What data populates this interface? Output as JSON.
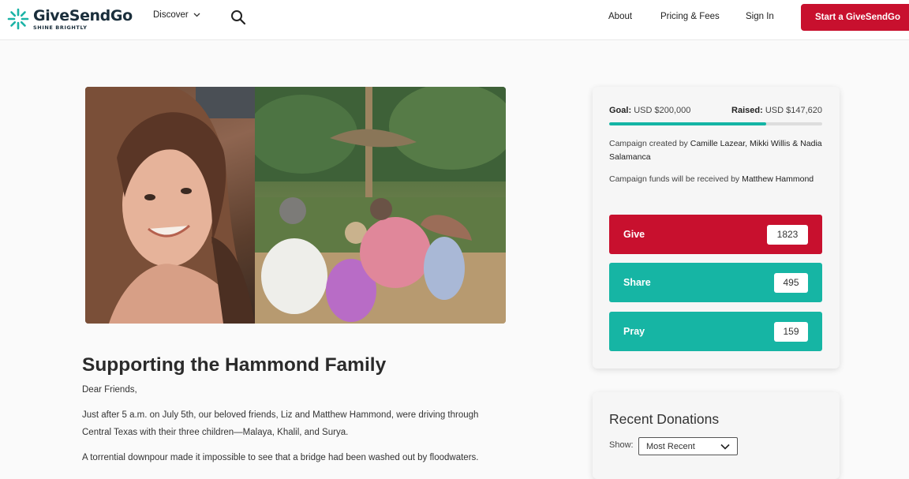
{
  "header": {
    "logo_word": "GiveSendGo",
    "logo_tagline": "SHINE BRIGHTLY",
    "discover_label": "Discover",
    "about_label": "About",
    "pricing_label": "Pricing & Fees",
    "signin_label": "Sign In",
    "start_label": "Start a GiveSendGo"
  },
  "campaign": {
    "title": "Supporting the Hammond Family",
    "paragraphs": [
      "Dear Friends,",
      "Just after 5 a.m. on July 5th, our beloved friends, Liz and Matthew Hammond, were driving through Central Texas with their three children—Malaya, Khalil, and Surya.",
      "A torrential downpour made it impossible to see that a bridge had been washed out by floodwaters."
    ]
  },
  "stats": {
    "goal_label": "Goal:",
    "goal_value": "USD $200,000",
    "raised_label": "Raised:",
    "raised_value": "USD $147,620",
    "progress_fraction": 0.738,
    "created_prefix": "Campaign created by",
    "created_names": "Camille Lazear, Mikki Willis & Nadia Salamanca",
    "received_prefix": "Campaign funds will be received by",
    "received_name": "Matthew Hammond",
    "give_label": "Give",
    "give_count": "1823",
    "share_label": "Share",
    "share_count": "495",
    "pray_label": "Pray",
    "pray_count": "159"
  },
  "donations": {
    "title": "Recent Donations",
    "show_label": "Show:",
    "filter_value": "Most Recent"
  },
  "colors": {
    "brand_red": "#c8102e",
    "teal": "#16b5a4",
    "logo_teal": "#1bb3a6"
  }
}
